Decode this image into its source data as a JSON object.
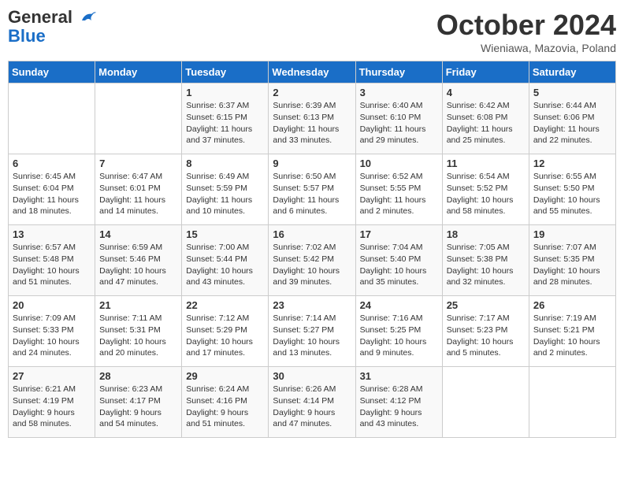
{
  "header": {
    "logo_line1": "General",
    "logo_line2": "Blue",
    "month": "October 2024",
    "location": "Wieniawa, Mazovia, Poland"
  },
  "weekdays": [
    "Sunday",
    "Monday",
    "Tuesday",
    "Wednesday",
    "Thursday",
    "Friday",
    "Saturday"
  ],
  "weeks": [
    [
      {
        "day": "",
        "sunrise": "",
        "sunset": "",
        "daylight": ""
      },
      {
        "day": "",
        "sunrise": "",
        "sunset": "",
        "daylight": ""
      },
      {
        "day": "1",
        "sunrise": "Sunrise: 6:37 AM",
        "sunset": "Sunset: 6:15 PM",
        "daylight": "Daylight: 11 hours and 37 minutes."
      },
      {
        "day": "2",
        "sunrise": "Sunrise: 6:39 AM",
        "sunset": "Sunset: 6:13 PM",
        "daylight": "Daylight: 11 hours and 33 minutes."
      },
      {
        "day": "3",
        "sunrise": "Sunrise: 6:40 AM",
        "sunset": "Sunset: 6:10 PM",
        "daylight": "Daylight: 11 hours and 29 minutes."
      },
      {
        "day": "4",
        "sunrise": "Sunrise: 6:42 AM",
        "sunset": "Sunset: 6:08 PM",
        "daylight": "Daylight: 11 hours and 25 minutes."
      },
      {
        "day": "5",
        "sunrise": "Sunrise: 6:44 AM",
        "sunset": "Sunset: 6:06 PM",
        "daylight": "Daylight: 11 hours and 22 minutes."
      }
    ],
    [
      {
        "day": "6",
        "sunrise": "Sunrise: 6:45 AM",
        "sunset": "Sunset: 6:04 PM",
        "daylight": "Daylight: 11 hours and 18 minutes."
      },
      {
        "day": "7",
        "sunrise": "Sunrise: 6:47 AM",
        "sunset": "Sunset: 6:01 PM",
        "daylight": "Daylight: 11 hours and 14 minutes."
      },
      {
        "day": "8",
        "sunrise": "Sunrise: 6:49 AM",
        "sunset": "Sunset: 5:59 PM",
        "daylight": "Daylight: 11 hours and 10 minutes."
      },
      {
        "day": "9",
        "sunrise": "Sunrise: 6:50 AM",
        "sunset": "Sunset: 5:57 PM",
        "daylight": "Daylight: 11 hours and 6 minutes."
      },
      {
        "day": "10",
        "sunrise": "Sunrise: 6:52 AM",
        "sunset": "Sunset: 5:55 PM",
        "daylight": "Daylight: 11 hours and 2 minutes."
      },
      {
        "day": "11",
        "sunrise": "Sunrise: 6:54 AM",
        "sunset": "Sunset: 5:52 PM",
        "daylight": "Daylight: 10 hours and 58 minutes."
      },
      {
        "day": "12",
        "sunrise": "Sunrise: 6:55 AM",
        "sunset": "Sunset: 5:50 PM",
        "daylight": "Daylight: 10 hours and 55 minutes."
      }
    ],
    [
      {
        "day": "13",
        "sunrise": "Sunrise: 6:57 AM",
        "sunset": "Sunset: 5:48 PM",
        "daylight": "Daylight: 10 hours and 51 minutes."
      },
      {
        "day": "14",
        "sunrise": "Sunrise: 6:59 AM",
        "sunset": "Sunset: 5:46 PM",
        "daylight": "Daylight: 10 hours and 47 minutes."
      },
      {
        "day": "15",
        "sunrise": "Sunrise: 7:00 AM",
        "sunset": "Sunset: 5:44 PM",
        "daylight": "Daylight: 10 hours and 43 minutes."
      },
      {
        "day": "16",
        "sunrise": "Sunrise: 7:02 AM",
        "sunset": "Sunset: 5:42 PM",
        "daylight": "Daylight: 10 hours and 39 minutes."
      },
      {
        "day": "17",
        "sunrise": "Sunrise: 7:04 AM",
        "sunset": "Sunset: 5:40 PM",
        "daylight": "Daylight: 10 hours and 35 minutes."
      },
      {
        "day": "18",
        "sunrise": "Sunrise: 7:05 AM",
        "sunset": "Sunset: 5:38 PM",
        "daylight": "Daylight: 10 hours and 32 minutes."
      },
      {
        "day": "19",
        "sunrise": "Sunrise: 7:07 AM",
        "sunset": "Sunset: 5:35 PM",
        "daylight": "Daylight: 10 hours and 28 minutes."
      }
    ],
    [
      {
        "day": "20",
        "sunrise": "Sunrise: 7:09 AM",
        "sunset": "Sunset: 5:33 PM",
        "daylight": "Daylight: 10 hours and 24 minutes."
      },
      {
        "day": "21",
        "sunrise": "Sunrise: 7:11 AM",
        "sunset": "Sunset: 5:31 PM",
        "daylight": "Daylight: 10 hours and 20 minutes."
      },
      {
        "day": "22",
        "sunrise": "Sunrise: 7:12 AM",
        "sunset": "Sunset: 5:29 PM",
        "daylight": "Daylight: 10 hours and 17 minutes."
      },
      {
        "day": "23",
        "sunrise": "Sunrise: 7:14 AM",
        "sunset": "Sunset: 5:27 PM",
        "daylight": "Daylight: 10 hours and 13 minutes."
      },
      {
        "day": "24",
        "sunrise": "Sunrise: 7:16 AM",
        "sunset": "Sunset: 5:25 PM",
        "daylight": "Daylight: 10 hours and 9 minutes."
      },
      {
        "day": "25",
        "sunrise": "Sunrise: 7:17 AM",
        "sunset": "Sunset: 5:23 PM",
        "daylight": "Daylight: 10 hours and 5 minutes."
      },
      {
        "day": "26",
        "sunrise": "Sunrise: 7:19 AM",
        "sunset": "Sunset: 5:21 PM",
        "daylight": "Daylight: 10 hours and 2 minutes."
      }
    ],
    [
      {
        "day": "27",
        "sunrise": "Sunrise: 6:21 AM",
        "sunset": "Sunset: 4:19 PM",
        "daylight": "Daylight: 9 hours and 58 minutes."
      },
      {
        "day": "28",
        "sunrise": "Sunrise: 6:23 AM",
        "sunset": "Sunset: 4:17 PM",
        "daylight": "Daylight: 9 hours and 54 minutes."
      },
      {
        "day": "29",
        "sunrise": "Sunrise: 6:24 AM",
        "sunset": "Sunset: 4:16 PM",
        "daylight": "Daylight: 9 hours and 51 minutes."
      },
      {
        "day": "30",
        "sunrise": "Sunrise: 6:26 AM",
        "sunset": "Sunset: 4:14 PM",
        "daylight": "Daylight: 9 hours and 47 minutes."
      },
      {
        "day": "31",
        "sunrise": "Sunrise: 6:28 AM",
        "sunset": "Sunset: 4:12 PM",
        "daylight": "Daylight: 9 hours and 43 minutes."
      },
      {
        "day": "",
        "sunrise": "",
        "sunset": "",
        "daylight": ""
      },
      {
        "day": "",
        "sunrise": "",
        "sunset": "",
        "daylight": ""
      }
    ]
  ]
}
